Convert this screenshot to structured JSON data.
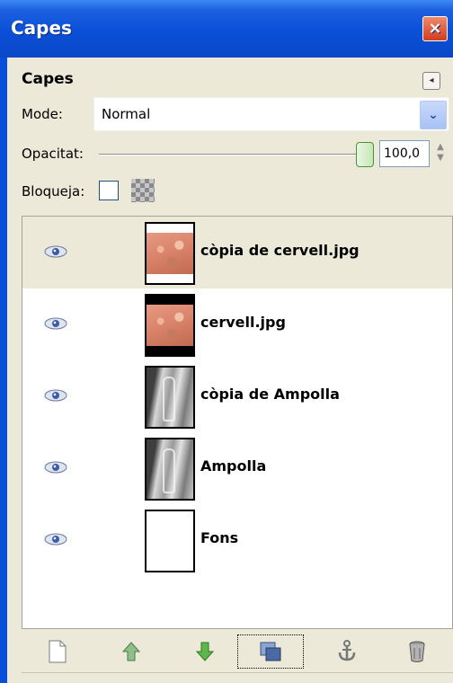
{
  "window": {
    "title": "Capes",
    "close_glyph": "×"
  },
  "panel": {
    "title": "Capes",
    "menu_icon": "triangle-left-icon"
  },
  "mode": {
    "label": "Mode:",
    "value": "Normal"
  },
  "opacity": {
    "label": "Opacitat:",
    "value": "100,0",
    "level": 1.0
  },
  "lock": {
    "label": "Bloqueja:"
  },
  "layers": [
    {
      "name": "còpia de cervell.jpg",
      "visible": true,
      "selected": true,
      "thumb": "brain-white"
    },
    {
      "name": "cervell.jpg",
      "visible": true,
      "selected": false,
      "thumb": "brain-black"
    },
    {
      "name": "còpia de Ampolla",
      "visible": true,
      "selected": false,
      "thumb": "bottle"
    },
    {
      "name": "Ampolla",
      "visible": true,
      "selected": false,
      "thumb": "bottle"
    },
    {
      "name": "Fons",
      "visible": true,
      "selected": false,
      "thumb": "white"
    }
  ],
  "toolbar": {
    "buttons": [
      "new-layer-icon",
      "raise-layer-icon",
      "lower-layer-icon",
      "duplicate-layer-icon",
      "anchor-layer-icon",
      "delete-layer-icon"
    ]
  },
  "colors": {
    "title_bar": "#0a4fd8",
    "panel_bg": "#ece9d8",
    "selected_row": "#ece9d8"
  }
}
